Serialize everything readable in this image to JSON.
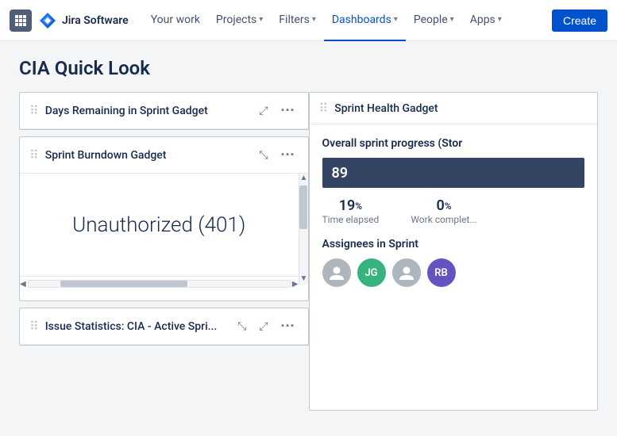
{
  "app": {
    "name": "Jira Software"
  },
  "navbar": {
    "grid_icon_label": "Apps menu",
    "logo_text": "Jira Software",
    "items": [
      {
        "label": "Your work",
        "active": false,
        "has_chevron": false
      },
      {
        "label": "Projects",
        "active": false,
        "has_chevron": true
      },
      {
        "label": "Filters",
        "active": false,
        "has_chevron": true
      },
      {
        "label": "Dashboards",
        "active": true,
        "has_chevron": true
      },
      {
        "label": "People",
        "active": false,
        "has_chevron": true
      },
      {
        "label": "Apps",
        "active": false,
        "has_chevron": true
      }
    ],
    "create_label": "Create"
  },
  "page": {
    "title": "CIA Quick Look"
  },
  "gadgets": {
    "days_remaining": {
      "title": "Days Remaining in Sprint Gadget"
    },
    "sprint_burndown": {
      "title": "Sprint Burndown Gadget",
      "unauthorized_text": "Unauthorized (401)"
    },
    "issue_statistics": {
      "title": "Issue Statistics: CIA - Active Spri..."
    },
    "sprint_health": {
      "title": "Sprint Health Gadget",
      "progress_label": "Overall sprint progress (Stor",
      "bar_value": "89",
      "stats": [
        {
          "value": "19",
          "pct": "%",
          "label": "Time elapsed"
        },
        {
          "value": "0",
          "pct": "%",
          "label": "Work complet..."
        }
      ],
      "assignees_label": "Assignees in Sprint",
      "assignees": [
        {
          "initials": "",
          "color": "#8993a4",
          "label": "User 1"
        },
        {
          "initials": "JG",
          "color": "#36b37e",
          "label": "JG"
        },
        {
          "initials": "",
          "color": "#8993a4",
          "label": "User 3"
        },
        {
          "initials": "RB",
          "color": "#6554c0",
          "label": "RB"
        }
      ]
    }
  }
}
